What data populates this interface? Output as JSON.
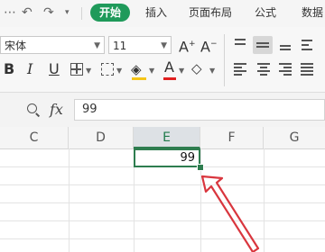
{
  "tabs": {
    "start": "开始",
    "insert": "插入",
    "page_layout": "页面布局",
    "formulas": "公式",
    "data": "数据"
  },
  "quick_icons": [
    "save-icon",
    "undo-icon",
    "redo-icon",
    "more-icon"
  ],
  "font": {
    "name": "宋体",
    "size": "11"
  },
  "format_labels": {
    "bold": "B",
    "italic": "I",
    "underline": "U",
    "grow": "A",
    "shrink": "A",
    "font_color": "A"
  },
  "formula_bar": {
    "fx": "fx",
    "value": "99"
  },
  "columns": [
    "C",
    "D",
    "E",
    "F",
    "G"
  ],
  "selected_column": "E",
  "active_cell": {
    "value": "99"
  },
  "colors": {
    "accent_green": "#1f9a5a",
    "selection_green": "#2e7d4f",
    "arrow_red": "#d9363e",
    "font_color_bar": "#e02020"
  }
}
